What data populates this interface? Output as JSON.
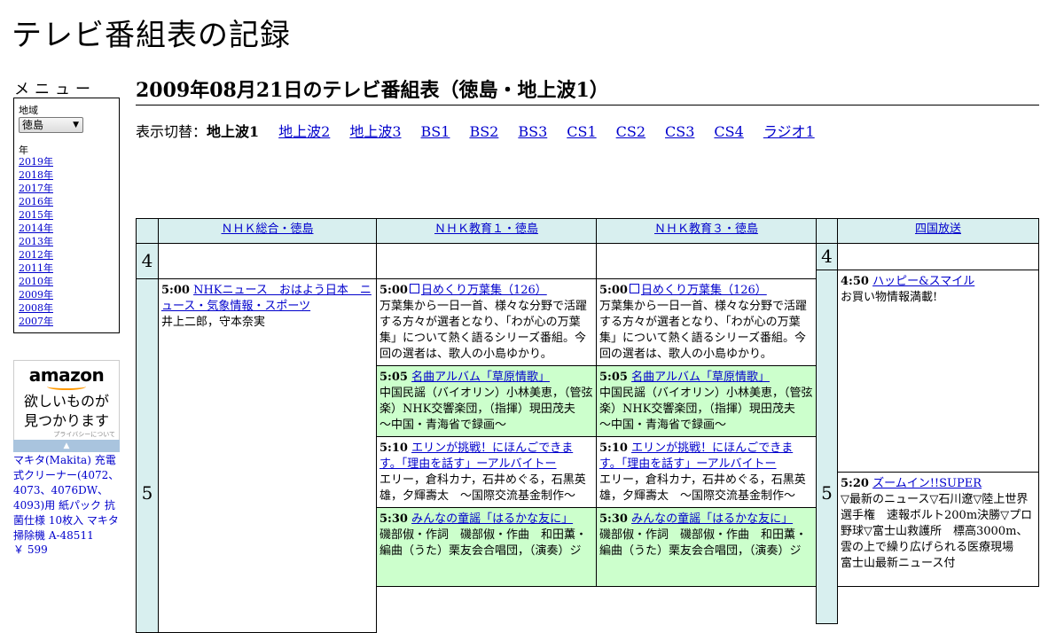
{
  "site_title": "テレビ番組表の記録",
  "menu": {
    "heading": "メニュー",
    "region_label": "地域",
    "region_value": "徳島",
    "year_label": "年",
    "years": [
      "2019年",
      "2018年",
      "2017年",
      "2016年",
      "2015年",
      "2014年",
      "2013年",
      "2012年",
      "2011年",
      "2010年",
      "2009年",
      "2008年",
      "2007年"
    ]
  },
  "ad": {
    "brand": "amazon",
    "copy1": "欲しいものが",
    "copy2": "見つかります",
    "privacy": "プライバシーについて",
    "product": "マキタ(Makita) 充電式クリーナー(4072、4073、4076DW、4093)用 紙パック 抗菌仕様 10枚入 マキタ 掃除機 A-48511",
    "price": "￥ 599"
  },
  "page_heading": "2009年08月21日のテレビ番組表（徳島・地上波1）",
  "switch": {
    "label": "表示切替：",
    "current": "地上波1",
    "links": [
      "地上波2",
      "地上波3",
      "BS1",
      "BS2",
      "BS3",
      "CS1",
      "CS2",
      "CS3",
      "CS4",
      "ラジオ1"
    ]
  },
  "channels": [
    "ＮＨＫ総合・徳島",
    "ＮＨＫ教育１・徳島",
    "ＮＨＫ教育３・徳島",
    "四国放送"
  ],
  "hours": [
    "4",
    "5"
  ],
  "programs": {
    "nhk_g_0500": {
      "time": "5:00",
      "title": "NHKニュース　おはよう日本　ニュース・気象情報・スポーツ",
      "desc": "井上二郎，守本奈実"
    },
    "e1_0500": {
      "time": "5:00",
      "title": "日めくり万葉集（126）",
      "desc": "万葉集から一日一首、様々な分野で活躍する方々が選者となり、「わが心の万葉集」について熱く語るシリーズ番組。今回の選者は、歌人の小島ゆかり。"
    },
    "e1_0505": {
      "time": "5:05",
      "title": "名曲アルバム「草原情歌」",
      "desc": "中国民謡（バイオリン）小林美恵，（管弦楽）NHK交響楽団，（指揮）現田茂夫　～中国・青海省で録画～"
    },
    "e1_0510": {
      "time": "5:10",
      "title": "エリンが挑戦！にほんごできます。「理由を話す」ーアルバイトー",
      "desc": "エリー，倉科カナ，石井めぐる，石黒英雄，夕輝壽太　～国際交流基金制作～"
    },
    "e1_0530": {
      "time": "5:30",
      "title": "みんなの童謡「はるかな友に」",
      "desc": "磯部俶・作詞　磯部俶・作曲　和田薫・編曲（うた）栗友会合唱団，（演奏）ジ"
    },
    "e3_0500": {
      "time": "5:00",
      "title": "日めくり万葉集（126）",
      "desc": "万葉集から一日一首、様々な分野で活躍する方々が選者となり、「わが心の万葉集」について熱く語るシリーズ番組。今回の選者は、歌人の小島ゆかり。"
    },
    "e3_0505": {
      "time": "5:05",
      "title": "名曲アルバム「草原情歌」",
      "desc": "中国民謡（バイオリン）小林美恵，（管弦楽）NHK交響楽団，（指揮）現田茂夫　～中国・青海省で録画～"
    },
    "e3_0510": {
      "time": "5:10",
      "title": "エリンが挑戦！にほんごできます。「理由を話す」ーアルバイトー",
      "desc": "エリー，倉科カナ，石井めぐる，石黒英雄，夕輝壽太　～国際交流基金制作～"
    },
    "e3_0530": {
      "time": "5:30",
      "title": "みんなの童謡「はるかな友に」",
      "desc": "磯部俶・作詞　磯部俶・作曲　和田薫・編曲（うた）栗友会合唱団，（演奏）ジ"
    },
    "jrt_0450": {
      "time": "4:50",
      "title": "ハッピー&スマイル",
      "desc": "お買い物情報満載!"
    },
    "jrt_0520": {
      "time": "5:20",
      "title": "ズームイン!!SUPER",
      "desc": "▽最新のニュース▽石川遼▽陸上世界選手権　速報ボルト200m決勝▽プロ野球▽富士山救護所　標高3000m、雲の上で繰り広げられる医療現場　富士山最新ニュース付"
    }
  }
}
